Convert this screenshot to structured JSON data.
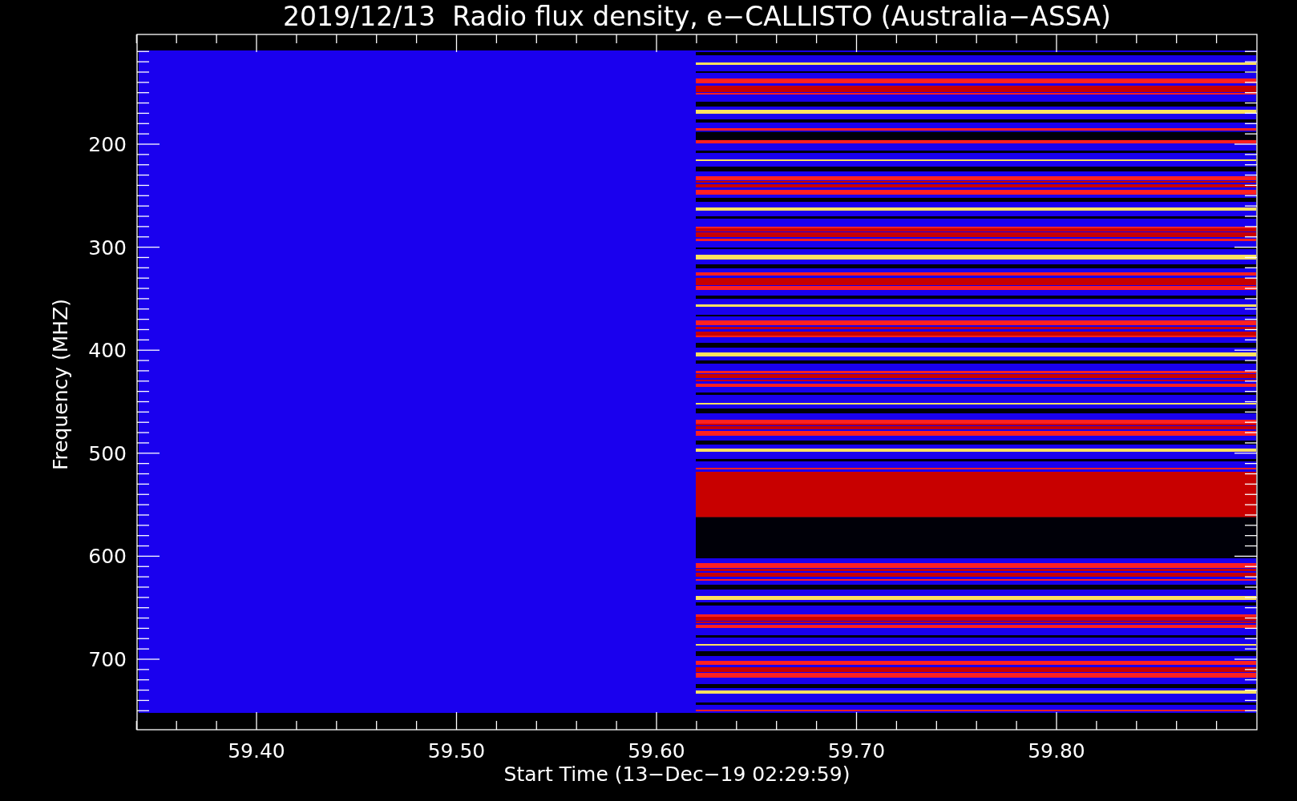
{
  "title": "2019/12/13  Radio flux density, e−CALLISTO (Australia−ASSA)",
  "y_axis": {
    "label": "Frequency (MHZ)",
    "tick_labels": [
      "200",
      "300",
      "400",
      "500",
      "600",
      "700"
    ]
  },
  "x_axis": {
    "label": "Start Time (13−Dec−19 02:29:59)",
    "tick_labels": [
      "59.40",
      "59.50",
      "59.60",
      "59.70",
      "59.80"
    ]
  }
}
